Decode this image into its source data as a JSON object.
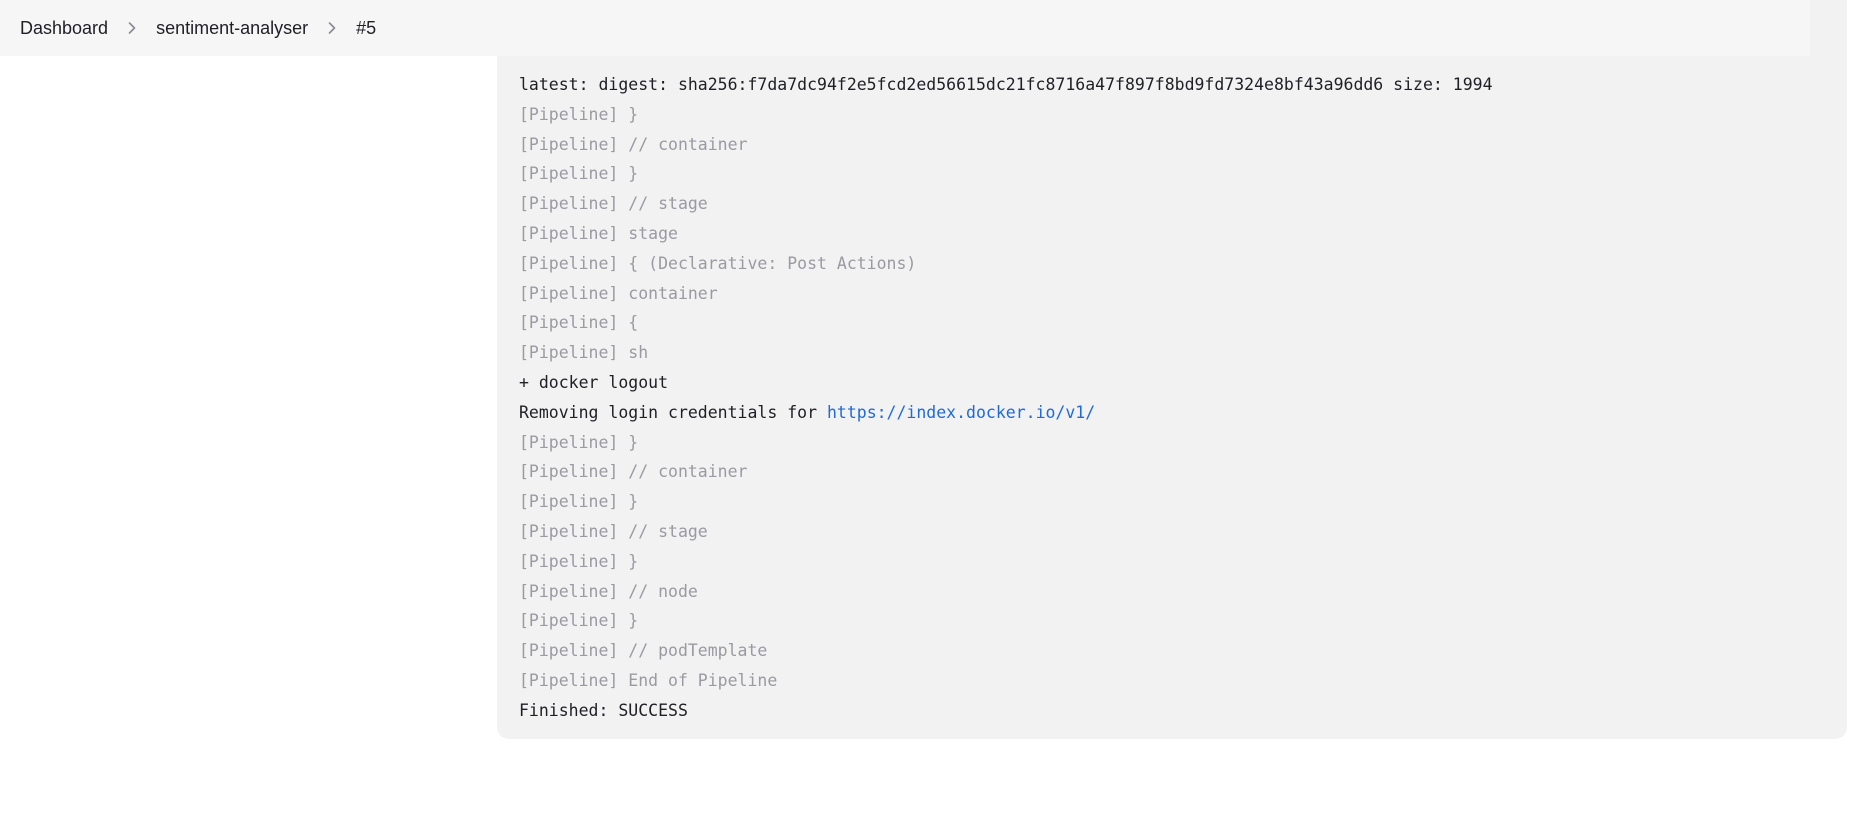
{
  "breadcrumb": {
    "items": [
      "Dashboard",
      "sentiment-analyser",
      "#5"
    ]
  },
  "colors": {
    "link": "#1e6ad8",
    "pipeline_text": "#9a9aa0",
    "console_bg": "#f2f2f3"
  },
  "console": {
    "lines": [
      "latest: digest: sha256:f7da7dc94f2e5fcd2ed56615dc21fc8716a47f897f8bd9fd7324e8bf43a96dd6 size: 1994",
      "[Pipeline] }",
      "[Pipeline] // container",
      "[Pipeline] }",
      "[Pipeline] // stage",
      "[Pipeline] stage",
      "[Pipeline] { (Declarative: Post Actions)",
      "[Pipeline] container",
      "[Pipeline] {",
      "[Pipeline] sh",
      "+ docker logout",
      "Removing login credentials for ",
      "[Pipeline] }",
      "[Pipeline] // container",
      "[Pipeline] }",
      "[Pipeline] // stage",
      "[Pipeline] }",
      "[Pipeline] // node",
      "[Pipeline] }",
      "[Pipeline] // podTemplate",
      "[Pipeline] End of Pipeline",
      "Finished: SUCCESS"
    ],
    "link_url_text": "https://index.docker.io/v1/"
  }
}
